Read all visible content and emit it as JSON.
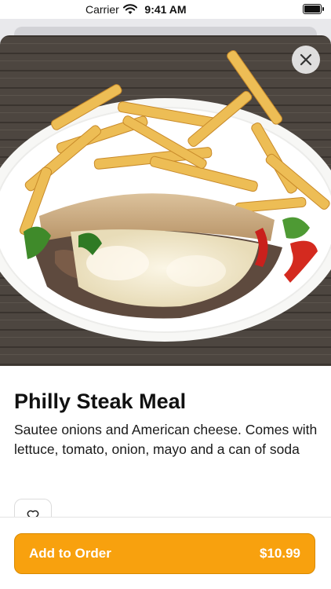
{
  "status_bar": {
    "carrier": "Carrier",
    "time": "9:41 AM",
    "battery_level": 1.0
  },
  "item": {
    "title": "Philly Steak Meal",
    "description": "Sautee onions and American cheese. Comes with lettuce, tomato, onion, mayo and a can of soda"
  },
  "icons": {
    "close": "close-icon",
    "favorite": "heart-outline-icon",
    "wifi": "wifi-icon",
    "battery": "battery-icon"
  },
  "order_button": {
    "label": "Add to Order",
    "price": "$10.99"
  },
  "colors": {
    "accent": "#f8a10e",
    "accent_border": "#d98a00"
  }
}
